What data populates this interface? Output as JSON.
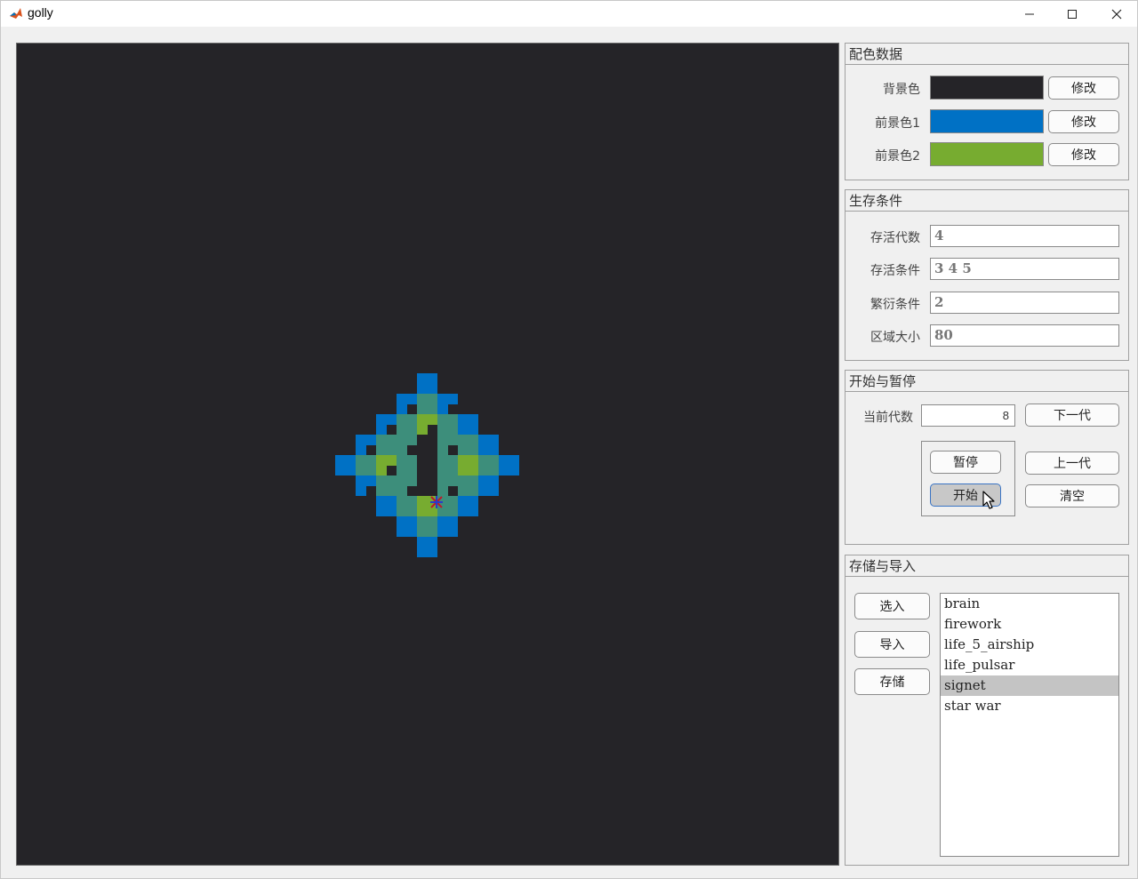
{
  "window": {
    "title": "golly",
    "minimize_label": "—",
    "maximize_label": "☐",
    "close_label": "✕"
  },
  "colors": {
    "background": "#252428",
    "foreground1": "#0071c5",
    "foreground2": "#77ac30",
    "blend": "#3d8e7b"
  },
  "color_panel": {
    "title": "配色数据",
    "rows": [
      {
        "label": "背景色",
        "color": "#252428",
        "button": "修改"
      },
      {
        "label": "前景色1",
        "color": "#0071c5",
        "button": "修改"
      },
      {
        "label": "前景色2",
        "color": "#77ac30",
        "button": "修改"
      }
    ]
  },
  "survival_panel": {
    "title": "生存条件",
    "fields": [
      {
        "label": "存活代数",
        "value": "4"
      },
      {
        "label": "存活条件",
        "value": "3 4 5"
      },
      {
        "label": "繁衍条件",
        "value": "2"
      },
      {
        "label": "区域大小",
        "value": "80"
      }
    ]
  },
  "run_panel": {
    "title": "开始与暂停",
    "generation_label": "当前代数",
    "generation_value": "8",
    "next_button": "下一代",
    "pause_button": "暂停",
    "prev_button": "上一代",
    "start_button": "开始",
    "clear_button": "清空"
  },
  "storage_panel": {
    "title": "存储与导入",
    "select_button": "选入",
    "import_button": "导入",
    "save_button": "存储",
    "list": [
      "brain",
      "firework",
      "life_5_airship",
      "life_pulsar",
      "signet",
      "star war"
    ],
    "selected": "signet"
  },
  "icons": {
    "app": "matlab-icon",
    "marker": "star-marker-icon",
    "cursor": "mouse-cursor-icon"
  }
}
